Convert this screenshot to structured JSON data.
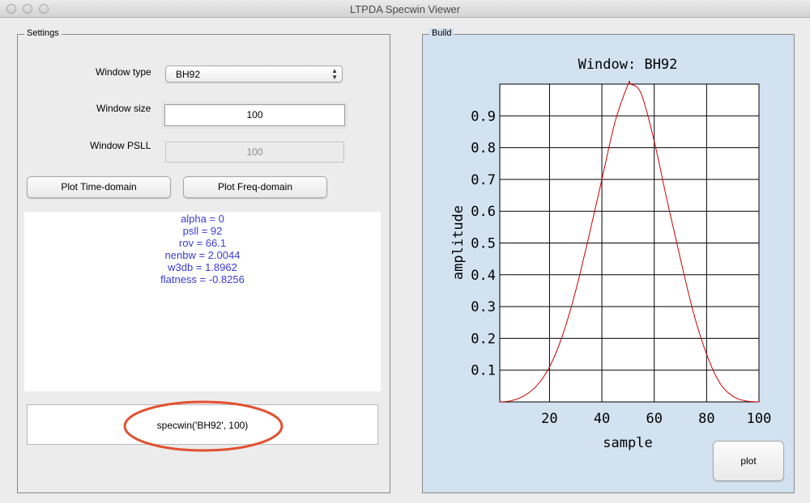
{
  "window": {
    "title": "LTPDA Specwin Viewer"
  },
  "settings": {
    "legend": "Settings",
    "window_type_label": "Window type",
    "window_type_value": "BH92",
    "window_size_label": "Window size",
    "window_size_value": "100",
    "window_psll_label": "Window PSLL",
    "window_psll_value": "100",
    "plot_time_label": "Plot Time-domain",
    "plot_freq_label": "Plot Freq-domain",
    "info_lines": [
      "alpha = 0",
      "psll = 92",
      "rov = 66.1",
      "nenbw = 2.0044",
      "w3db = 1.8962",
      "flatness = -0.8256"
    ],
    "command": "specwin('BH92', 100)",
    "highlight_color": "#e2502f"
  },
  "build": {
    "legend": "Build",
    "plot_button_label": "plot",
    "background_color": "#d3e2f1"
  },
  "chart_data": {
    "type": "line",
    "title": "Window: BH92",
    "xlabel": "sample",
    "ylabel": "amplitude",
    "xlim": [
      1,
      100
    ],
    "ylim": [
      0,
      1
    ],
    "grid": true,
    "xticks": [
      20,
      40,
      60,
      80,
      100
    ],
    "yticks": [
      0.1,
      0.2,
      0.3,
      0.4,
      0.5,
      0.6,
      0.7,
      0.8,
      0.9
    ],
    "series": [
      {
        "color": "#cc0000",
        "x": [
          1,
          5,
          10,
          15,
          20,
          25,
          30,
          35,
          40,
          45,
          50,
          51,
          55,
          60,
          65,
          70,
          75,
          80,
          85,
          90,
          95,
          100
        ],
        "y": [
          0.0001,
          0.003,
          0.018,
          0.05,
          0.11,
          0.21,
          0.35,
          0.52,
          0.7,
          0.88,
          0.999,
          1.0,
          0.97,
          0.82,
          0.63,
          0.45,
          0.28,
          0.15,
          0.06,
          0.018,
          0.003,
          0.0001
        ]
      }
    ]
  }
}
